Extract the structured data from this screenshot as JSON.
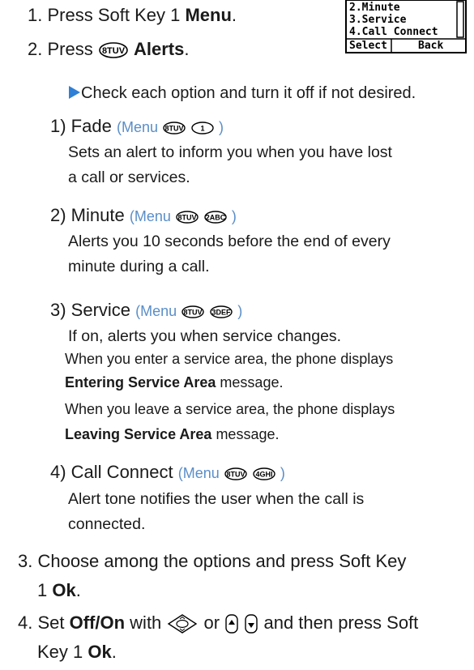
{
  "screen": {
    "lines": [
      "2.Minute",
      "3.Service",
      "4.Call Connect"
    ],
    "softkey_left": "Select",
    "softkey_right": "Back"
  },
  "steps": {
    "s1_num": "1.",
    "s1_text": "Press Soft Key 1",
    "s1_bold": "Menu",
    "s1_end": ".",
    "s2_num": "2.",
    "s2_text": "Press",
    "s2_bold": "Alerts",
    "s2_end": ".",
    "note": "Check each option and turn it off if not desired.",
    "s3_line1": "3. Choose among the options and press Soft Key",
    "s3_line2_pre": "1",
    "s3_bold": "Ok",
    "s3_end": ".",
    "s4_pre": "4. Set",
    "s4_bold1": "Off/On",
    "s4_with": "with",
    "s4_or": "or",
    "s4_then": "and then press Soft",
    "s4_line2_pre": "Key 1",
    "s4_bold2": "Ok",
    "s4_end": "."
  },
  "options": [
    {
      "title": "1) Fade",
      "menu_label": "(Menu",
      "close": ")",
      "key1": "8TUV",
      "key2": "1",
      "desc": [
        "Sets an alert to inform you when you have lost",
        "a call or services."
      ]
    },
    {
      "title": "2) Minute",
      "menu_label": "(Menu",
      "close": ")",
      "key1": "8TUV",
      "key2": "2ABC",
      "desc": [
        "Alerts you 10 seconds before the end of every",
        "minute during a call."
      ]
    },
    {
      "title": "3) Service",
      "menu_label": "(Menu",
      "close": ")",
      "key1": "8TUV",
      "key2": "3DEF",
      "desc": [
        "If on, alerts you when service changes."
      ],
      "extra": [
        {
          "text": "When you enter a service area, the phone displays"
        },
        {
          "bold": "Entering Service Area",
          "text": " message."
        },
        {
          "text": "When you leave a service area, the phone displays"
        },
        {
          "bold": "Leaving Service Area",
          "text": " message."
        }
      ]
    },
    {
      "title": "4) Call Connect",
      "menu_label": "(Menu",
      "close": ")",
      "key1": "8TUV",
      "key2": "4GHI",
      "desc": [
        "Alert tone notifies the user when the call is",
        "connected."
      ]
    }
  ],
  "colors": {
    "menu_ref": "#5a8ec8",
    "arrow": "#2e7fd6",
    "text": "#1a1a1a"
  },
  "icons": {
    "nav_key": "navigation-key-icon",
    "side_keys": "side-volume-keys-icon"
  }
}
